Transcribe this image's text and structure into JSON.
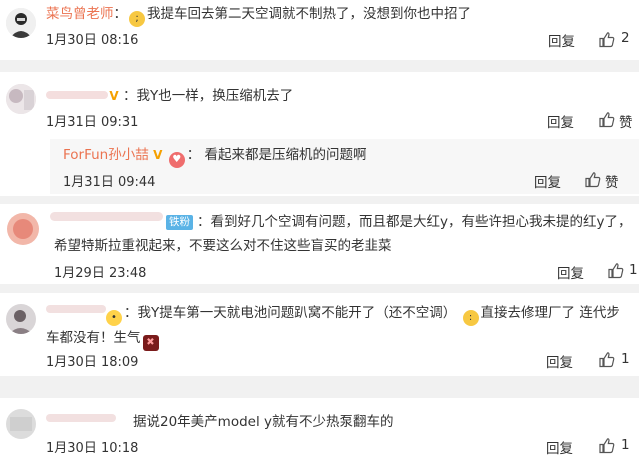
{
  "actions": {
    "reply": "回复",
    "like": "赞"
  },
  "comments": [
    {
      "user": "菜鸟曾老师",
      "text": "我提车回去第二天空调就不制热了，没想到你也中招了",
      "time": "1月30日 08:16",
      "likes": "2"
    },
    {
      "text": "我Y也一样，换压缩机去了",
      "time": "1月31日 09:31",
      "reply": {
        "user": "ForFun孙小喆",
        "text": "看起来都是压缩机的问题啊",
        "time": "1月31日 09:44"
      }
    },
    {
      "tag": "铁粉",
      "text_line1": "看到好几个空调有问题，而且都是大红y，有些许担心我未提的红y了，",
      "text_line2": "希望特斯拉重视起来，不要这么对不住这些盲买的老韭菜",
      "time": "1月29日 23:48",
      "likes": "1"
    },
    {
      "text_line1a": "我Y提车第一天就电池问题趴窝不能开了（还不空调）",
      "text_line1b": "直接去修理厂了 连代步",
      "text_line2": "车都没有！生气",
      "time": "1月30日 18:09",
      "likes": "1"
    },
    {
      "text": "据说20年美产model y就有不少热泵翻车的",
      "time": "1月30日 10:18",
      "likes": "1"
    }
  ],
  "colors": {
    "username": "#eb7350",
    "link": "#0e6bbf",
    "tag": "#5ab3e6",
    "background": "#f1f1f1"
  }
}
